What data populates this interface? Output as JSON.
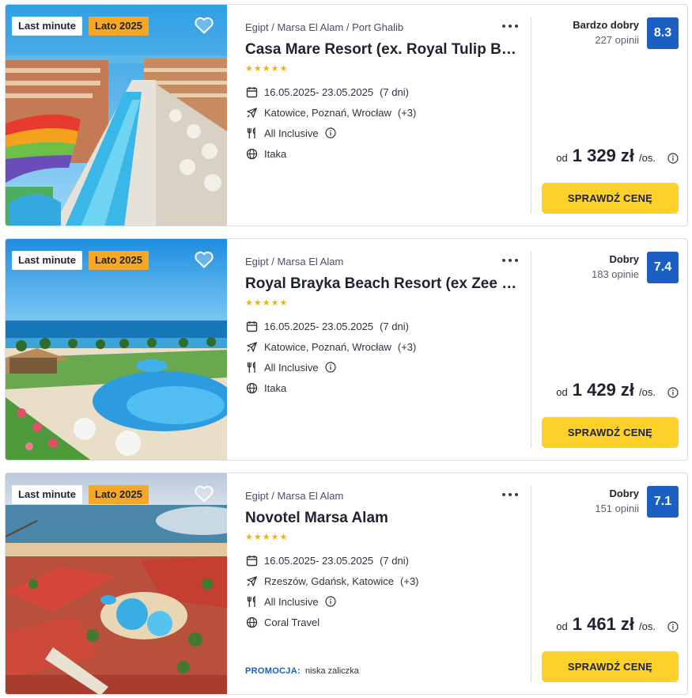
{
  "colors": {
    "accent_button": "#fdd02a",
    "rating_box": "#1b5fc2",
    "season_badge": "#f7a823",
    "stars": "#f5b400",
    "promo_label": "#1b5fc2"
  },
  "icons": {
    "favorite": "heart-icon",
    "more": "more-dots-icon",
    "date": "calendar-icon",
    "flight": "plane-icon",
    "board": "cutlery-icon",
    "operator": "globe-icon",
    "info": "info-icon"
  },
  "offers": [
    {
      "badge_last_minute": "Last minute",
      "badge_season": "Lato 2025",
      "location": "Egipt / Marsa El Alam / Port Ghalib",
      "title": "Casa Mare Resort (ex. Royal Tulip Beach Resort)",
      "stars": "★★★★★",
      "star_count": 5,
      "dates": "16.05.2025- 23.05.2025",
      "duration": "(7 dni)",
      "departures": "Katowice, Poznań, Wrocław",
      "departures_more": "(+3)",
      "board": "All Inclusive",
      "operator": "Itaka",
      "rating_label": "Bardzo dobry",
      "rating_count": "227 opinii",
      "rating_score": "8.3",
      "price_prefix": "od",
      "price": "1 329 zł",
      "price_unit": "/os.",
      "cta": "SPRAWDŹ CENĘ"
    },
    {
      "badge_last_minute": "Last minute",
      "badge_season": "Lato 2025",
      "location": "Egipt / Marsa El Alam",
      "title": "Royal Brayka Beach Resort (ex Zee Brayka Bay)",
      "stars": "★★★★★",
      "star_count": 5,
      "dates": "16.05.2025- 23.05.2025",
      "duration": "(7 dni)",
      "departures": "Katowice, Poznań, Wrocław",
      "departures_more": "(+3)",
      "board": "All Inclusive",
      "operator": "Itaka",
      "rating_label": "Dobry",
      "rating_count": "183 opinie",
      "rating_score": "7.4",
      "price_prefix": "od",
      "price": "1 429 zł",
      "price_unit": "/os.",
      "cta": "SPRAWDŹ CENĘ"
    },
    {
      "badge_last_minute": "Last minute",
      "badge_season": "Lato 2025",
      "location": "Egipt / Marsa El Alam",
      "title": "Novotel Marsa Alam",
      "stars": "★★★★★",
      "star_count": 5,
      "dates": "16.05.2025- 23.05.2025",
      "duration": "(7 dni)",
      "departures": "Rzeszów, Gdańsk, Katowice",
      "departures_more": "(+3)",
      "board": "All Inclusive",
      "operator": "Coral Travel",
      "promo_label": "PROMOCJA:",
      "promo_text": "niska zaliczka",
      "rating_label": "Dobry",
      "rating_count": "151 opinii",
      "rating_score": "7.1",
      "price_prefix": "od",
      "price": "1 461 zł",
      "price_unit": "/os.",
      "cta": "SPRAWDŹ CENĘ"
    }
  ]
}
